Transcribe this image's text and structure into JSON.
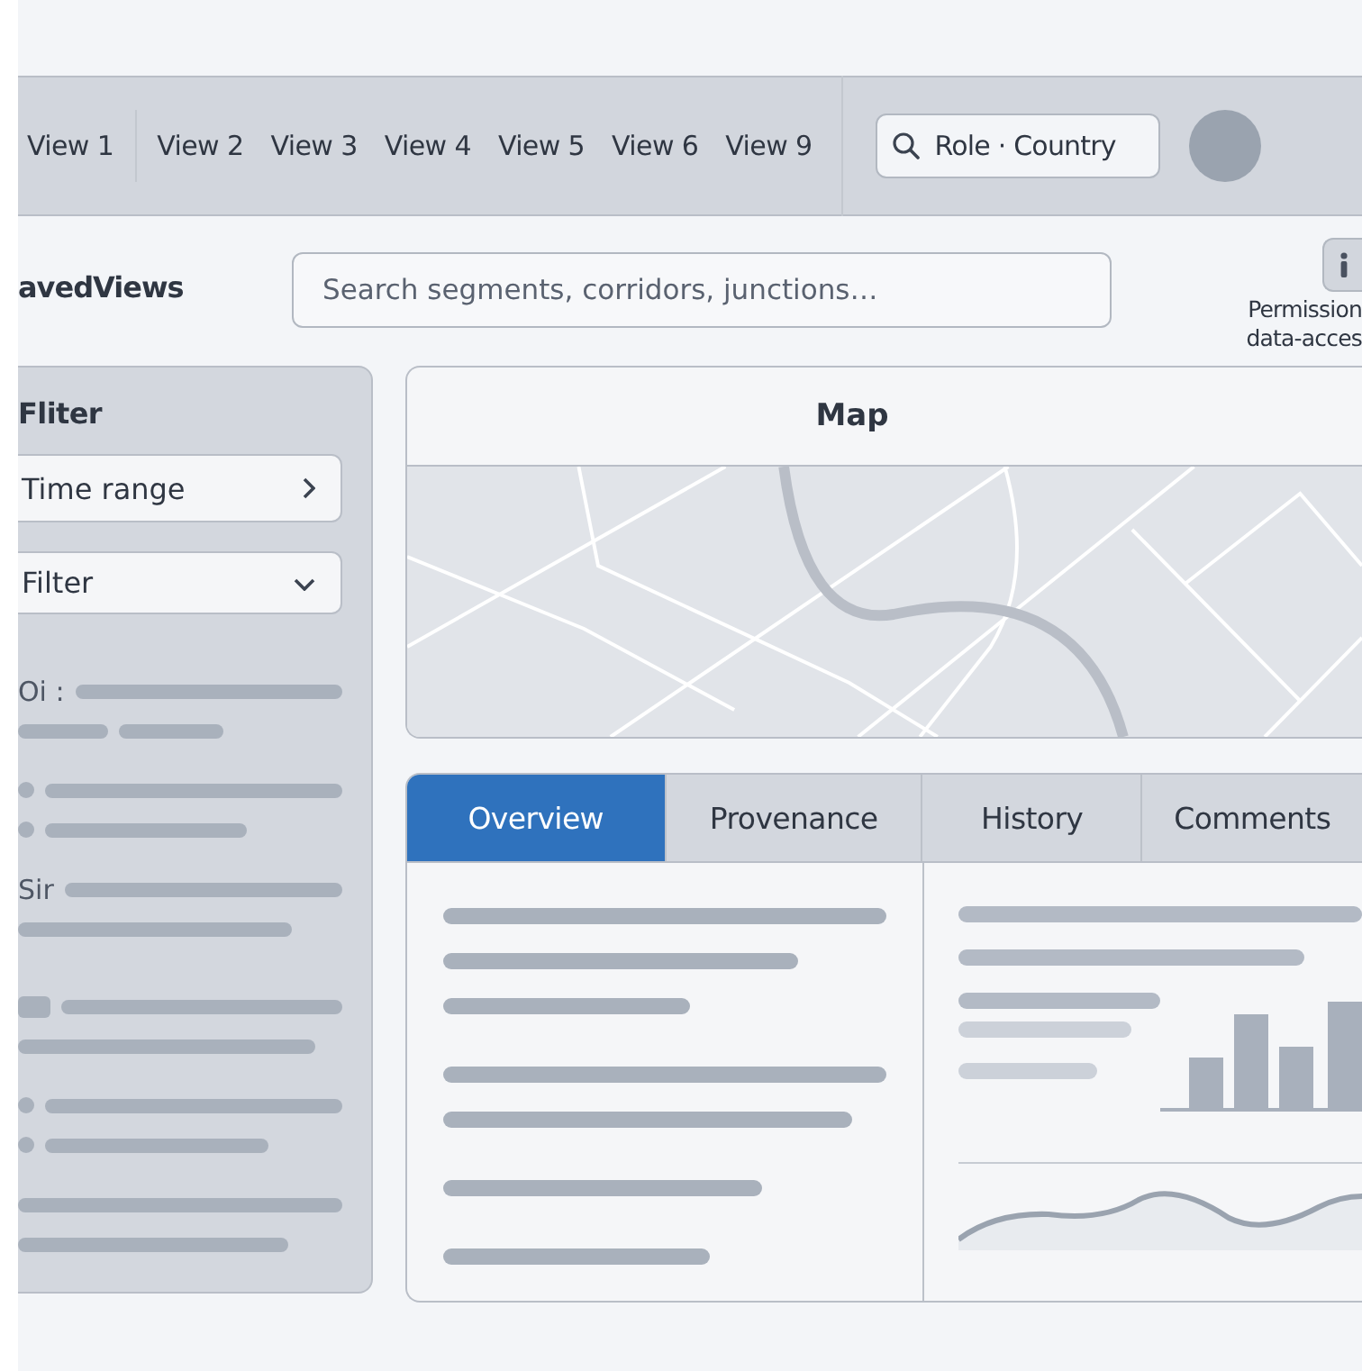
{
  "top_tabs": [
    "View 1",
    "View 2",
    "View 3",
    "View 4",
    "View 5",
    "View 6",
    "View 9"
  ],
  "role_search": {
    "value": "Role · Country"
  },
  "saved_views": {
    "title": "avedViews"
  },
  "search": {
    "placeholder": "Search segments, corridors, junctions…"
  },
  "permission_note": [
    "Permission",
    "data-acces"
  ],
  "filter_panel": {
    "title": "Fliter",
    "controls": [
      {
        "kind": "link",
        "label": "Time range"
      },
      {
        "kind": "dropdown",
        "label": "Filter"
      }
    ],
    "labels": [
      "Oi :",
      "Sir"
    ]
  },
  "map": {
    "title": "Map"
  },
  "detail_tabs": [
    {
      "label": "Overview",
      "selected": true
    },
    {
      "label": "Provenance",
      "selected": false
    },
    {
      "label": "History",
      "selected": false
    },
    {
      "label": "Comments",
      "selected": false
    }
  ]
}
